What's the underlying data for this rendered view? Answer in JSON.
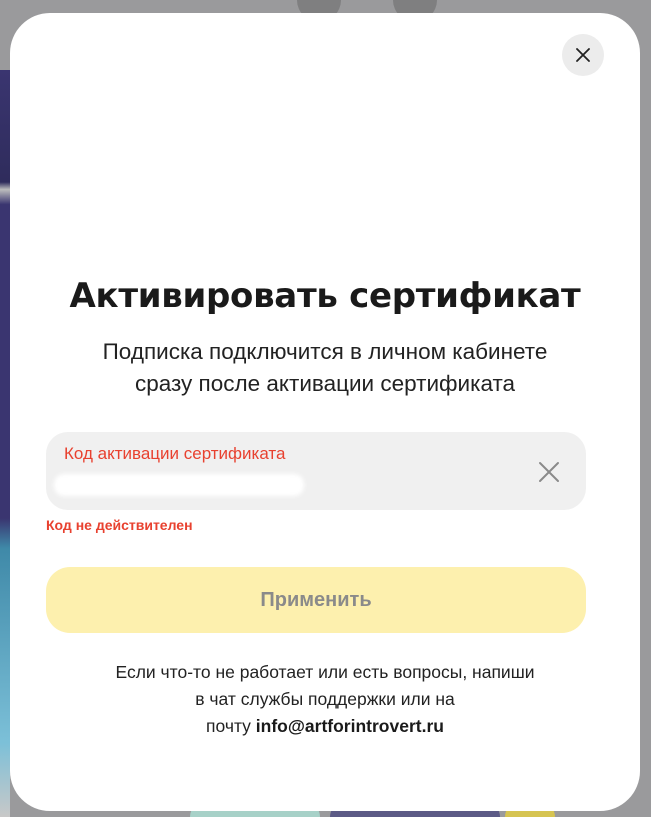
{
  "modal": {
    "title": "Активировать сертификат",
    "subtitle_line1": "Подписка подключится в личном кабинете",
    "subtitle_line2": "сразу после активации сертификата",
    "close_icon": "close-icon"
  },
  "code_field": {
    "label": "Код активации сертификата",
    "value": "",
    "clear_icon": "close-icon",
    "error": "Код не действителен"
  },
  "apply_button": {
    "label": "Применить"
  },
  "support": {
    "line1": "Если что-то не работает или есть вопросы, напиши",
    "line2": "в чат службы поддержки или на",
    "line3_prefix": "почту ",
    "email": "info@artforintrovert.ru"
  },
  "colors": {
    "error": "#e8412f",
    "button_bg": "#fdf0ae",
    "button_text": "#8a8a8a",
    "field_bg": "#f0f0f0"
  }
}
